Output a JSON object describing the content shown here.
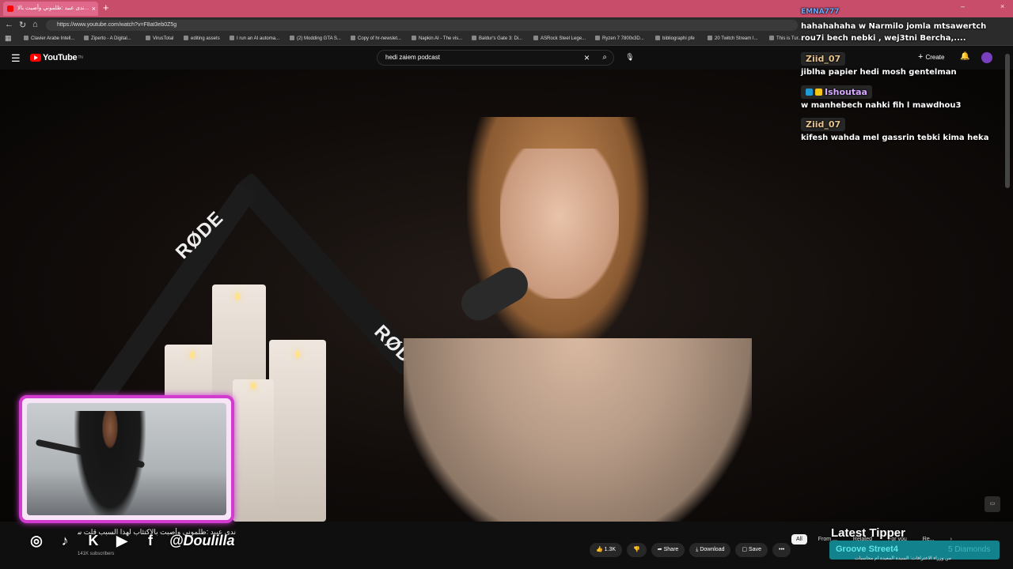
{
  "browser": {
    "tab_title": "ندى عبيد :ظلموني وأصبت بالا...",
    "new_tab": "+",
    "url": "https://www.youtube.com/watch?v=F8at3eb0Z5g",
    "bookmarks": [
      "Clavier Arabe Intell...",
      "Ziperto - A Digital...",
      "VirusTotal",
      "editing assets",
      "I run an AI automa...",
      "(2) Modding GTA S...",
      "Copy of hr-newslet...",
      "Napkin AI - The vis...",
      "Baldur's Gate 3: Di...",
      "ASRock Steel Lege...",
      "Ryzen 7 7800x3D...",
      "bibliographi pfe",
      "20 Twitch Stream I...",
      "This is Tur..."
    ]
  },
  "youtube": {
    "logo": "YouTube",
    "logo_sup": "TN",
    "search_value": "hedi zaiem podcast",
    "create_label": "Create"
  },
  "chat": {
    "top_user": "EMNA777",
    "messages": [
      {
        "user": "",
        "text": "hahahahaha w Narmilo jomla mtsawertch rou7i bech nebki , wej3tni Bercha,...."
      },
      {
        "user": "Ziid_07",
        "text": "jiblha papier hedi mosh gentelman"
      },
      {
        "user": "Ishoutaa",
        "text": "w manhebech nahki fih l mawdhou3"
      },
      {
        "user": "Ziid_07",
        "text": "kifesh wahda mel gassrin tebki kima heka"
      }
    ]
  },
  "overlay": {
    "handle": "@Doulilla",
    "latest_tipper_title": "Latest Tipper",
    "latest_tipper_name": "Groove Street4",
    "latest_tipper_amount": "5 Diamonds"
  },
  "video_info": {
    "title": "ندى عبيد :ظلموني وأصبت بالاكتئاب لهذا السبب قلت سوء كان",
    "subscribers": "141K subscribers",
    "likes": "1.3K",
    "share": "Share",
    "download": "Download",
    "save": "Save",
    "more": "•••"
  },
  "related": {
    "chips": [
      "All",
      "From ...",
      "Related",
      "For you",
      "Re..."
    ],
    "first_item": "من وزراء الاعترافات: السيدة المعيدة ام محاسبات"
  },
  "video_scene": {
    "rode_label_1": "RØDE",
    "rode_label_2": "RØDE"
  }
}
